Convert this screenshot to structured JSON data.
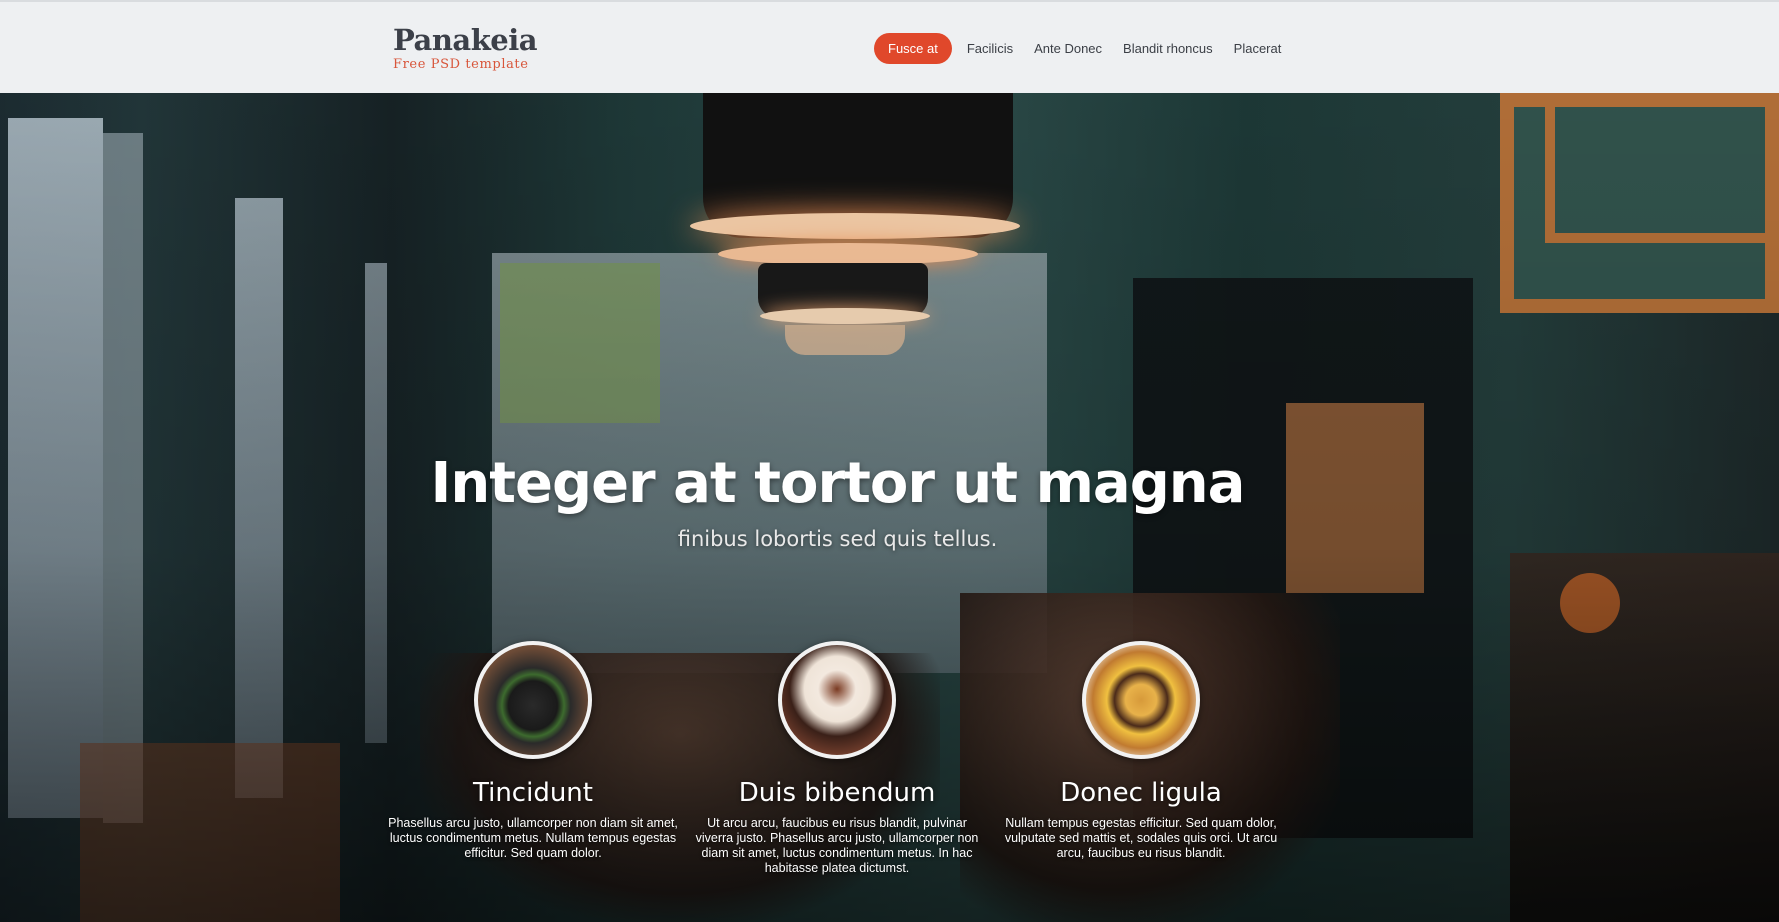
{
  "header": {
    "logo_title": "Panakeia",
    "logo_subtitle": "Free PSD template",
    "nav": [
      {
        "label": "Fusce at",
        "active": true
      },
      {
        "label": "Facilicis",
        "active": false
      },
      {
        "label": "Ante Donec",
        "active": false
      },
      {
        "label": "Blandit rhoncus",
        "active": false
      },
      {
        "label": "Placerat",
        "active": false
      }
    ]
  },
  "hero": {
    "headline": "Integer at tortor ut magna",
    "subheadline": "finibus lobortis sed quis tellus.",
    "background_image": "restaurant-interior-photo"
  },
  "features": [
    {
      "image": "black-bun-burger-photo",
      "title": "Tincidunt",
      "text": "Phasellus arcu justo, ullamcorper non diam sit amet, luctus condimentum metus. Nullam tempus egestas efficitur. Sed quam dolor."
    },
    {
      "image": "cupcake-photo",
      "title": "Duis bibendum",
      "text": "Ut arcu arcu, faucibus eu risus blandit, pulvinar viverra justo. Phasellus arcu justo, ullamcorper non diam sit amet, luctus condimentum metus. In hac habitasse platea dictumst."
    },
    {
      "image": "cheeseburger-photo",
      "title": "Donec ligula",
      "text": "Nullam tempus egestas efficitur. Sed quam dolor, vulputate sed mattis et, sodales quis orci. Ut arcu arcu, faucibus eu risus blandit."
    }
  ],
  "colors": {
    "accent": "#e0482b",
    "header_bg": "#eef0f2",
    "logo_text": "#3c4049"
  }
}
